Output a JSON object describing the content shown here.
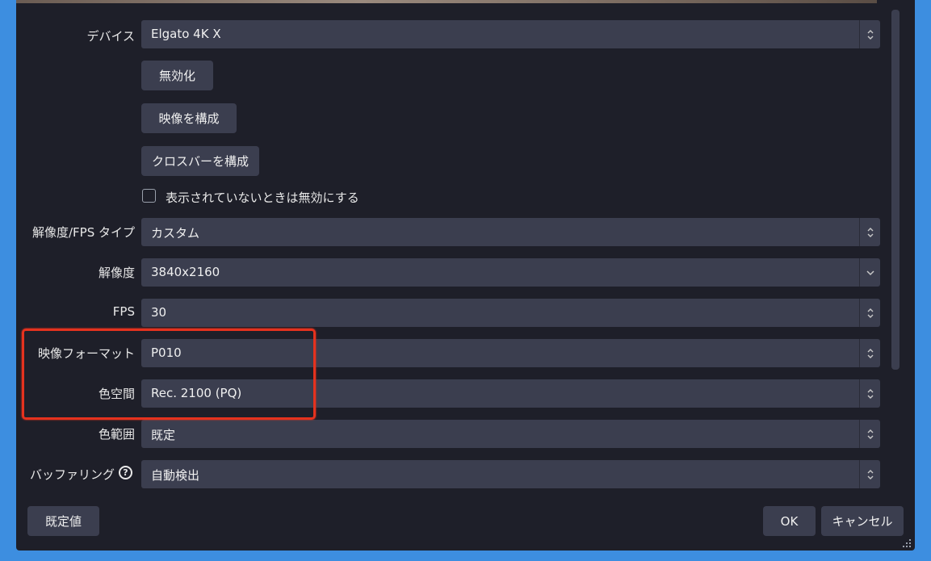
{
  "form": {
    "device_label": "デバイス",
    "device_value": "Elgato 4K X",
    "deactivate_label": "無効化",
    "configure_video_label": "映像を構成",
    "configure_crossbar_label": "クロスバーを構成",
    "deactivate_when_hidden_label": "表示されていないときは無効にする",
    "res_fps_type_label": "解像度/FPS タイプ",
    "res_fps_type_value": "カスタム",
    "resolution_label": "解像度",
    "resolution_value": "3840x2160",
    "fps_label": "FPS",
    "fps_value": "30",
    "video_format_label": "映像フォーマット",
    "video_format_value": "P010",
    "color_space_label": "色空間",
    "color_space_value": "Rec. 2100 (PQ)",
    "color_range_label": "色範囲",
    "color_range_value": "既定",
    "buffering_label": "バッファリング",
    "buffering_value": "自動検出",
    "help_icon_glyph": "?"
  },
  "footer": {
    "defaults_label": "既定値",
    "ok_label": "OK",
    "cancel_label": "キャンセル"
  },
  "icons": {
    "spin_arrows": "updown-arrows-icon",
    "dropdown_arrow": "chevron-down-icon",
    "help": "question-circle-icon",
    "resize": "resize-grip-icon"
  },
  "colors": {
    "background": "#1e1f29",
    "control": "#3b3e4f",
    "highlight": "#e5321e",
    "desktop": "#3d8ee0"
  }
}
